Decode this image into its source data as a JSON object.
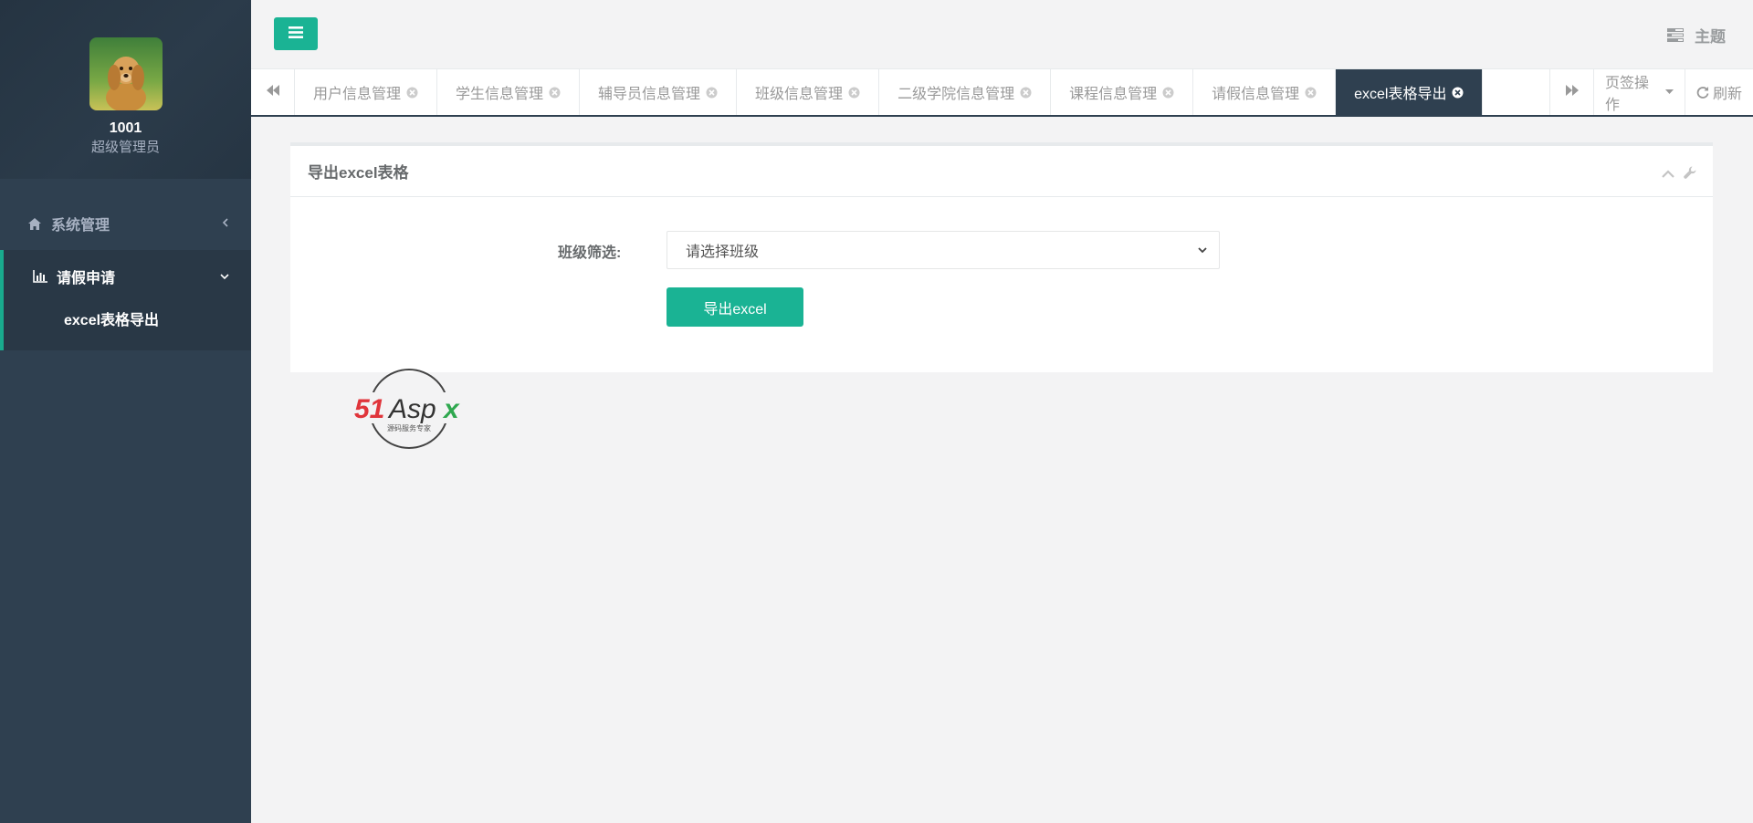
{
  "sidebar": {
    "user": {
      "id": "1001",
      "role": "超级管理员"
    },
    "menu": [
      {
        "label": "系统管理",
        "icon": "home-icon"
      },
      {
        "label": "请假申请",
        "icon": "bar-chart-icon",
        "children": [
          {
            "label": "excel表格导出"
          }
        ]
      }
    ]
  },
  "topbar": {
    "theme_label": "主题"
  },
  "tabs": [
    {
      "label": "用户信息管理"
    },
    {
      "label": "学生信息管理"
    },
    {
      "label": "辅导员信息管理"
    },
    {
      "label": "班级信息管理"
    },
    {
      "label": "二级学院信息管理"
    },
    {
      "label": "课程信息管理"
    },
    {
      "label": "请假信息管理"
    },
    {
      "label": "excel表格导出"
    }
  ],
  "tab_actions": {
    "page_ops": "页签操作",
    "refresh": "刷新"
  },
  "panel": {
    "title": "导出excel表格",
    "filter_label": "班级筛选:",
    "select_value": "请选择班级",
    "export_button": "导出excel"
  },
  "watermark": {
    "brand": "51Aspx",
    "tagline": "源码服务专家"
  },
  "colors": {
    "sidebar": "#2f4050",
    "accent": "#1ab394",
    "active_tab": "#2f4050"
  }
}
